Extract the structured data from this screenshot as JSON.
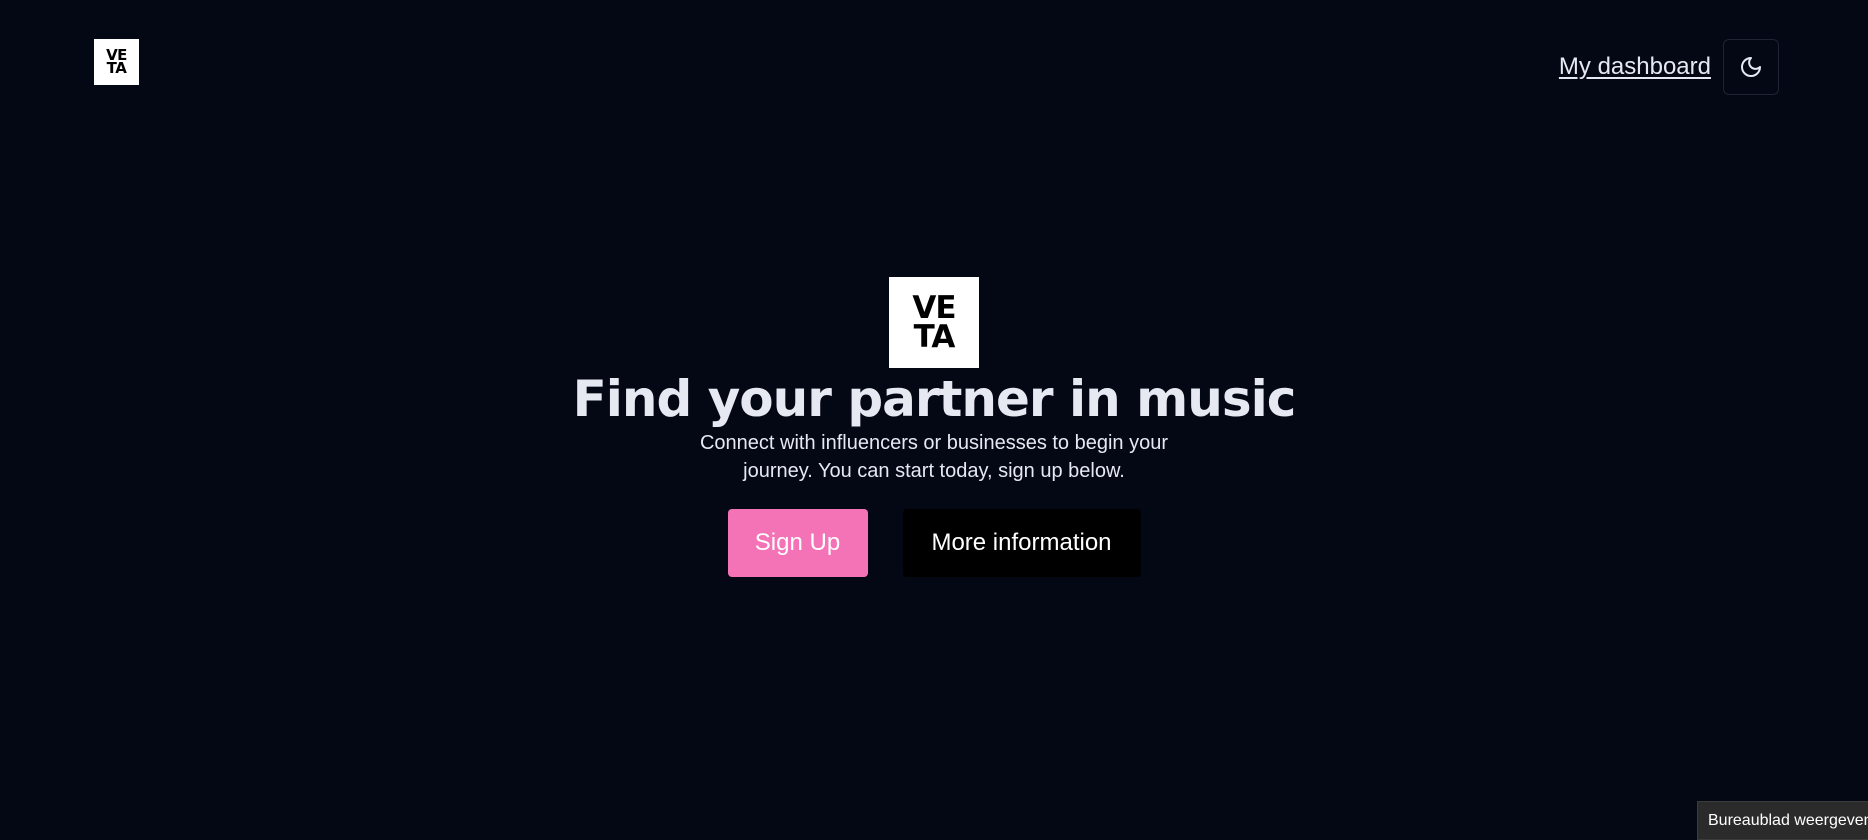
{
  "header": {
    "logo": {
      "line1": "VE",
      "line2": "TA"
    },
    "dashboard_link": "My dashboard",
    "theme_toggle_icon": "moon-icon"
  },
  "hero": {
    "logo": {
      "line1": "VE",
      "line2": "TA"
    },
    "title": "Find your partner in music",
    "subtitle": "Connect with influencers or businesses to begin your journey. You can start today, sign up below.",
    "primary_button": "Sign Up",
    "secondary_button": "More information"
  },
  "os_tooltip": {
    "text": "Bureaublad weergeven"
  },
  "colors": {
    "background": "#040714",
    "text": "#e6e8f2",
    "accent": "#f472b6",
    "secondary_button": "#000000"
  }
}
